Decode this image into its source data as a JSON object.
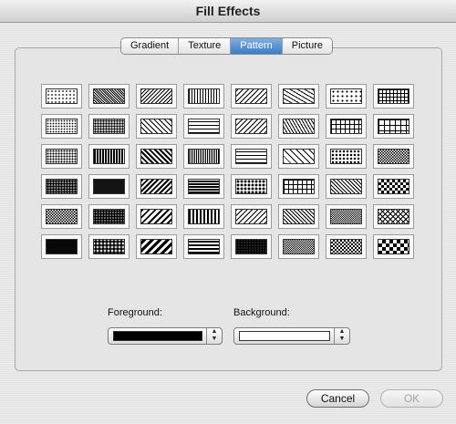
{
  "window": {
    "title": "Fill Effects"
  },
  "tabs": [
    {
      "label": "Gradient",
      "active": false
    },
    {
      "label": "Texture",
      "active": false
    },
    {
      "label": "Pattern",
      "active": true
    },
    {
      "label": "Picture",
      "active": false
    }
  ],
  "pattern_grid": {
    "rows": 6,
    "columns": 8,
    "selected_index": null
  },
  "foreground": {
    "label": "Foreground:",
    "color": "#000000"
  },
  "background": {
    "label": "Background:",
    "color": "#ffffff"
  },
  "buttons": {
    "cancel": "Cancel",
    "ok": "OK",
    "ok_enabled": false
  }
}
